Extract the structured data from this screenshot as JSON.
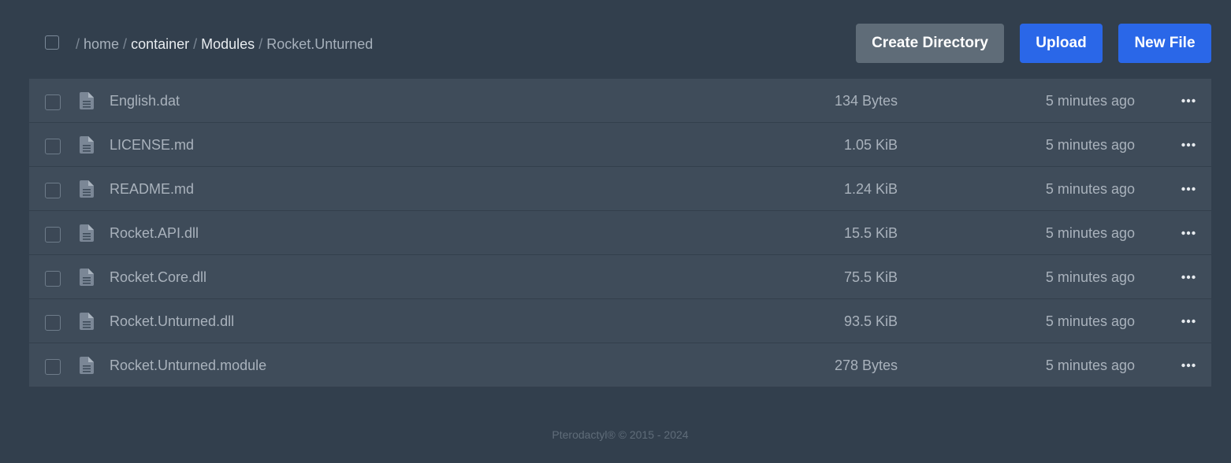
{
  "breadcrumb": {
    "segments": [
      {
        "label": "home"
      },
      {
        "label": "container"
      },
      {
        "label": "Modules"
      },
      {
        "label": "Rocket.Unturned"
      }
    ]
  },
  "actions": {
    "create_directory_label": "Create Directory",
    "upload_label": "Upload",
    "new_file_label": "New File"
  },
  "files": [
    {
      "name": "English.dat",
      "size": "134 Bytes",
      "modified": "5 minutes ago"
    },
    {
      "name": "LICENSE.md",
      "size": "1.05 KiB",
      "modified": "5 minutes ago"
    },
    {
      "name": "README.md",
      "size": "1.24 KiB",
      "modified": "5 minutes ago"
    },
    {
      "name": "Rocket.API.dll",
      "size": "15.5 KiB",
      "modified": "5 minutes ago"
    },
    {
      "name": "Rocket.Core.dll",
      "size": "75.5 KiB",
      "modified": "5 minutes ago"
    },
    {
      "name": "Rocket.Unturned.dll",
      "size": "93.5 KiB",
      "modified": "5 minutes ago"
    },
    {
      "name": "Rocket.Unturned.module",
      "size": "278 Bytes",
      "modified": "5 minutes ago"
    }
  ],
  "icons": {
    "file": "file-text-icon",
    "more": "more-horizontal-icon"
  },
  "colors": {
    "background": "#323f4d",
    "row": "#3e4b59",
    "primary_button": "#2a67e8",
    "secondary_button": "#5f6c78"
  },
  "footer": {
    "text": "Pterodactyl® © 2015 - 2024"
  }
}
